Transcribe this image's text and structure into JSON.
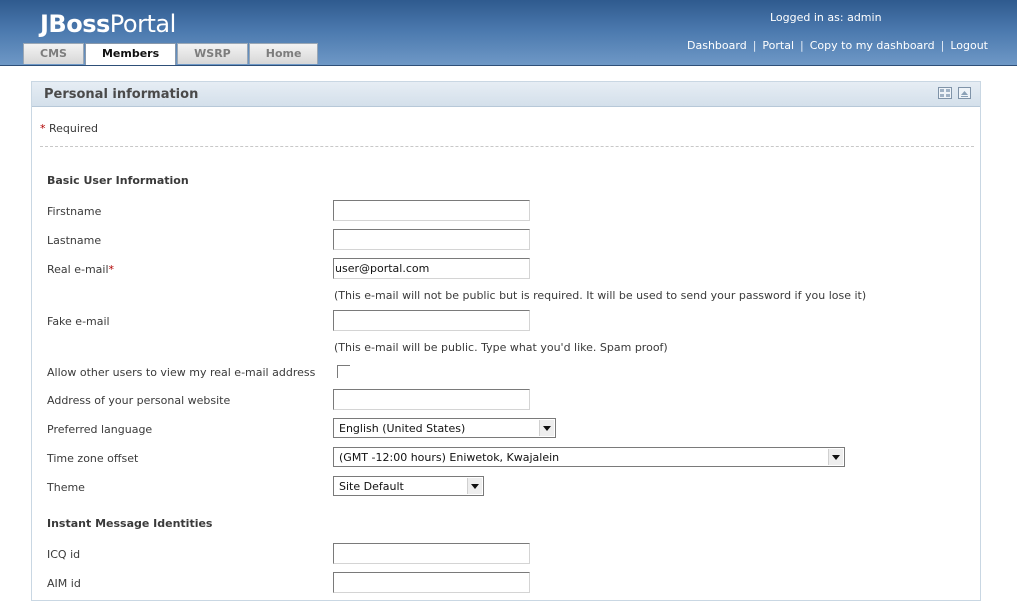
{
  "header": {
    "logo_part1": "JBoss",
    "logo_part2": "Portal",
    "logged_in": "Logged in as: admin",
    "links": [
      "Dashboard",
      "Portal",
      "Copy to my dashboard",
      "Logout"
    ],
    "tabs": [
      {
        "label": "CMS",
        "active": false
      },
      {
        "label": "Members",
        "active": true
      },
      {
        "label": "WSRP",
        "active": false
      },
      {
        "label": "Home",
        "active": false
      }
    ]
  },
  "portlet": {
    "title": "Personal information",
    "icons": [
      "maximize-icon",
      "minimize-icon"
    ]
  },
  "form": {
    "required_star": "*",
    "required_label": "Required",
    "basic_section": "Basic User Information",
    "firstname_label": "Firstname",
    "firstname_value": "",
    "lastname_label": "Lastname",
    "lastname_value": "",
    "real_email_label": "Real e-mail",
    "real_email_value": "user@portal.com",
    "real_email_hint": "(This e-mail will not be public but is required. It will be used to send your password if you lose it)",
    "fake_email_label": "Fake e-mail",
    "fake_email_value": "",
    "fake_email_hint": "(This e-mail will be public. Type what you'd like. Spam proof)",
    "allow_view_label": "Allow other users to view my real e-mail address",
    "allow_view_checked": false,
    "website_label": "Address of your personal website",
    "website_value": "",
    "language_label": "Preferred language",
    "language_value": "English (United States)",
    "timezone_label": "Time zone offset",
    "timezone_value": "(GMT -12:00 hours) Eniwetok, Kwajalein",
    "theme_label": "Theme",
    "theme_value": "Site Default",
    "im_section": "Instant Message Identities",
    "icq_label": "ICQ id",
    "icq_value": "",
    "aim_label": "AIM id",
    "aim_value": ""
  },
  "colors": {
    "header_blue": "#4a78ad",
    "title_bar": "#dde7f0",
    "required_red": "#b00000"
  }
}
